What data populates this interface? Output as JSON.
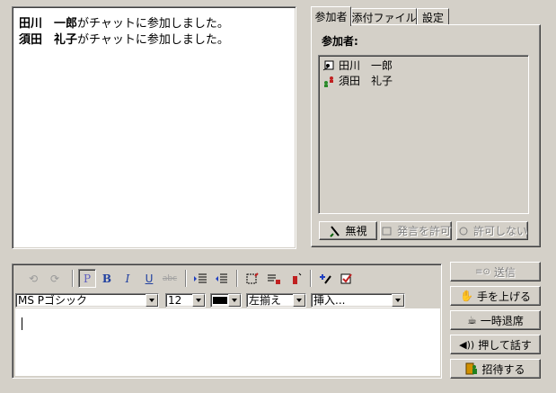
{
  "chat": {
    "messages": [
      {
        "name": "田川　一郎",
        "text": "がチャットに参加しました。"
      },
      {
        "name": "須田　礼子",
        "text": "がチャットに参加しました。"
      }
    ]
  },
  "tabs": [
    {
      "label": "参加者"
    },
    {
      "label": "添付ファイル"
    },
    {
      "label": "設定"
    }
  ],
  "participants": {
    "heading": "参加者:",
    "items": [
      {
        "name": "田川　一郎",
        "icon": "presenter-icon"
      },
      {
        "name": "須田　礼子",
        "icon": "users-icon"
      }
    ],
    "ignore_label": "無視",
    "allow_speak_label": "発言を許可",
    "deny_label": "許可しない"
  },
  "toolbar": {
    "font_name": "MS Pゴシック",
    "font_size": "12",
    "alignment": "左揃え",
    "insert": "挿入..."
  },
  "actions": {
    "send_label": "送信",
    "raise_hand_label": "手を上げる",
    "away_label": "一時退席",
    "push_to_talk_label": "押して話す",
    "invite_label": "招待する"
  },
  "colors": {
    "face": "#d4d0c8",
    "text_color_swatch": "#000000"
  }
}
